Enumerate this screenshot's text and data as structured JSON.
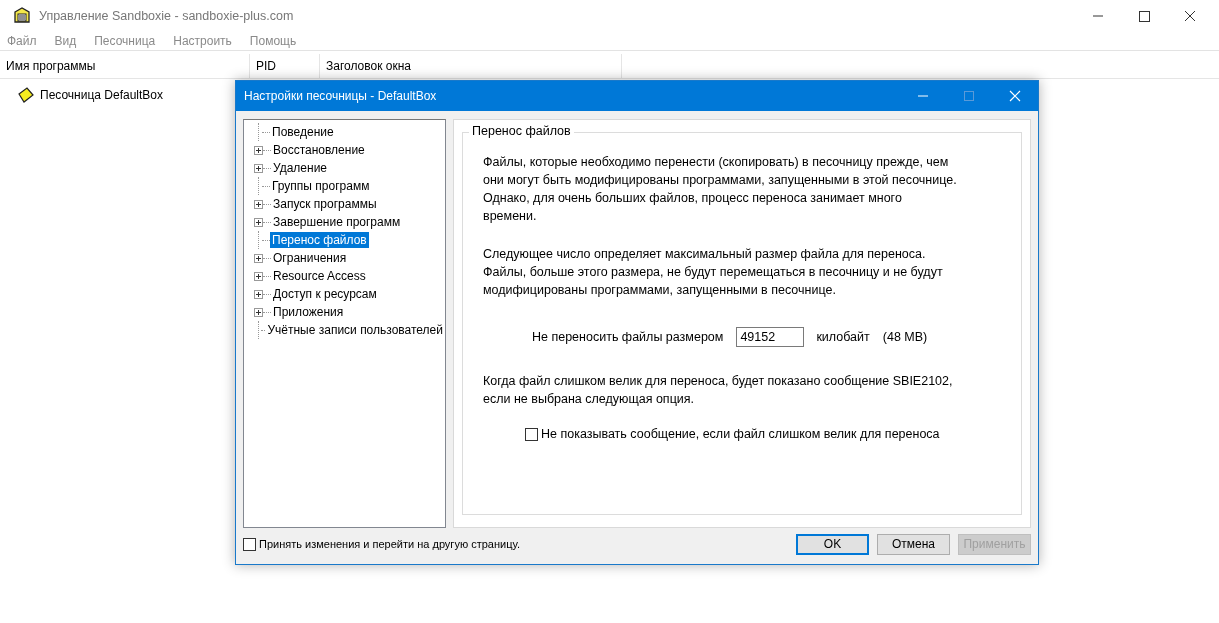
{
  "window": {
    "title": "Управление Sandboxie - sandboxie-plus.com"
  },
  "menu": [
    {
      "label": "Файл",
      "disabled": true
    },
    {
      "label": "Вид",
      "disabled": true
    },
    {
      "label": "Песочница",
      "disabled": true
    },
    {
      "label": "Настроить",
      "disabled": true
    },
    {
      "label": "Помощь",
      "disabled": true
    }
  ],
  "table": {
    "columns": [
      "Имя программы",
      "PID",
      "Заголовок окна"
    ],
    "rows": [
      {
        "name": "Песочница DefaultBox"
      }
    ]
  },
  "dialog": {
    "title": "Настройки песочницы - DefaultBox",
    "tree": [
      {
        "label": "Поведение",
        "expandable": false,
        "selected": false
      },
      {
        "label": "Восстановление",
        "expandable": true,
        "selected": false
      },
      {
        "label": "Удаление",
        "expandable": true,
        "selected": false
      },
      {
        "label": "Группы программ",
        "expandable": false,
        "selected": false
      },
      {
        "label": "Запуск программы",
        "expandable": true,
        "selected": false
      },
      {
        "label": "Завершение программ",
        "expandable": true,
        "selected": false
      },
      {
        "label": "Перенос файлов",
        "expandable": false,
        "selected": true
      },
      {
        "label": "Ограничения",
        "expandable": true,
        "selected": false
      },
      {
        "label": "Resource Access",
        "expandable": true,
        "selected": false
      },
      {
        "label": "Доступ к ресурсам",
        "expandable": true,
        "selected": false
      },
      {
        "label": "Приложения",
        "expandable": true,
        "selected": false
      },
      {
        "label": "Учётные записи пользователей",
        "expandable": false,
        "selected": false
      }
    ],
    "group_title": "Перенос файлов",
    "paragraph_1": "Файлы, которые необходимо перенести (скопировать) в песочницу прежде, чем они могут быть модифицированы программами, запущенными в этой песочнице.  Однако, для очень больших файлов, процесс переноса занимает много времени.",
    "paragraph_2": "Следующее число определяет максимальный размер файла для переноса. Файлы, больше этого размера, не будут перемещаться в песочницу и не будут модифицированы программами, запущенными в песочнице.",
    "size_label": "Не переносить файлы размером",
    "size_value": "49152",
    "size_unit": "килобайт",
    "size_note": "(48 MB)",
    "paragraph_3": "Когда файл слишком велик для переноса, будет показано сообщение SBIE2102, если не выбрана следующая опция.",
    "suppress_option": {
      "label": "Не показывать сообщение, если файл слишком велик для переноса",
      "checked": false
    },
    "apply_on_switch": {
      "label": "Принять изменения и перейти на другую страницу.",
      "checked": false
    },
    "buttons": [
      {
        "label": "OK",
        "default": true,
        "disabled": false
      },
      {
        "label": "Отмена",
        "default": false,
        "disabled": false
      },
      {
        "label": "Применить",
        "default": false,
        "disabled": true
      }
    ]
  }
}
